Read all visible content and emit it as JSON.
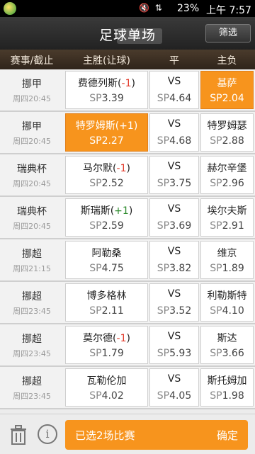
{
  "status": {
    "signal_icons": "🔇 ⇅",
    "battery": "23%",
    "time": "上午 7:57"
  },
  "header": {
    "title": "足球单场",
    "filter_label": "筛选",
    "music_label": "♫ ♪"
  },
  "columns": {
    "league": "赛事/截止",
    "home": "主胜(让球)",
    "draw": "平",
    "away": "主负"
  },
  "matches": [
    {
      "league": "挪甲",
      "datetime": "周四20:45",
      "home": "费德列斯",
      "handicap": "-1",
      "sp_home": "3.39",
      "draw": "VS",
      "sp_draw": "4.64",
      "away": "基萨",
      "sp_away": "2.04"
    },
    {
      "league": "挪甲",
      "datetime": "周四20:45",
      "home": "特罗姆斯",
      "handicap": "+1",
      "sp_home": "2.27",
      "draw": "VS",
      "sp_draw": "4.68",
      "away": "特罗姆瑟",
      "sp_away": "2.88"
    },
    {
      "league": "瑞典杯",
      "datetime": "周四20:45",
      "home": "马尔默",
      "handicap": "-1",
      "sp_home": "2.52",
      "draw": "VS",
      "sp_draw": "3.75",
      "away": "赫尔辛堡",
      "sp_away": "2.96"
    },
    {
      "league": "瑞典杯",
      "datetime": "周四20:45",
      "home": "斯瑞斯",
      "handicap": "+1",
      "sp_home": "2.59",
      "draw": "VS",
      "sp_draw": "3.69",
      "away": "埃尔夫斯",
      "sp_away": "2.91"
    },
    {
      "league": "挪超",
      "datetime": "周四21:15",
      "home": "阿勒桑",
      "handicap": "",
      "sp_home": "4.75",
      "draw": "VS",
      "sp_draw": "3.82",
      "away": "维京",
      "sp_away": "1.89"
    },
    {
      "league": "挪超",
      "datetime": "周四23:45",
      "home": "博多格林",
      "handicap": "",
      "sp_home": "2.11",
      "draw": "VS",
      "sp_draw": "3.52",
      "away": "利勒斯特",
      "sp_away": "4.10"
    },
    {
      "league": "挪超",
      "datetime": "周四23:45",
      "home": "莫尔德",
      "handicap": "-1",
      "sp_home": "1.79",
      "draw": "VS",
      "sp_draw": "5.93",
      "away": "斯达",
      "sp_away": "3.66"
    },
    {
      "league": "挪超",
      "datetime": "周四23:45",
      "home": "瓦勒伦加",
      "handicap": "",
      "sp_home": "4.02",
      "draw": "VS",
      "sp_draw": "4.05",
      "away": "斯托姆加",
      "sp_away": "1.98"
    }
  ],
  "sp_label": "SP",
  "bottom": {
    "selected_text": "已选2场比赛",
    "confirm_label": "确定",
    "info_symbol": "i"
  },
  "colors": {
    "accent": "#f7941d",
    "negative": "#e23b2c",
    "positive": "#2e8b2e"
  }
}
